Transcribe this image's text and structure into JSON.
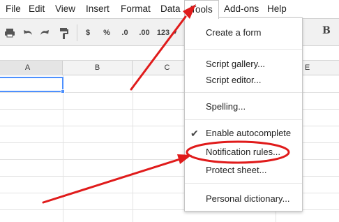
{
  "menubar": {
    "items": [
      {
        "label": "File"
      },
      {
        "label": "Edit"
      },
      {
        "label": "View"
      },
      {
        "label": "Insert"
      },
      {
        "label": "Format"
      },
      {
        "label": "Data"
      },
      {
        "label": "Tools"
      },
      {
        "label": "Add-ons"
      },
      {
        "label": "Help"
      }
    ],
    "active": "Tools"
  },
  "toolbar": {
    "icons": [
      "print-icon",
      "undo-icon",
      "redo-icon",
      "paint-format-icon"
    ],
    "currency_label": "$",
    "percent_label": "%",
    "decrease_decimals_label": ".0",
    "increase_decimals_label": ".00",
    "more_formats_label": "123",
    "bold_label": "B"
  },
  "grid": {
    "columns": [
      "A",
      "B",
      "C",
      "E"
    ],
    "selected_cell": "A"
  },
  "tools_menu": {
    "items": [
      {
        "label": "Create a form"
      },
      {
        "label": "Script gallery..."
      },
      {
        "label": "Script editor..."
      },
      {
        "label": "Spelling..."
      },
      {
        "label": "Enable autocomplete",
        "checked": true
      },
      {
        "label": "Notification rules..."
      },
      {
        "label": "Protect sheet..."
      },
      {
        "label": "Personal dictionary..."
      }
    ]
  },
  "annotation": {
    "color": "#e01b1b"
  }
}
